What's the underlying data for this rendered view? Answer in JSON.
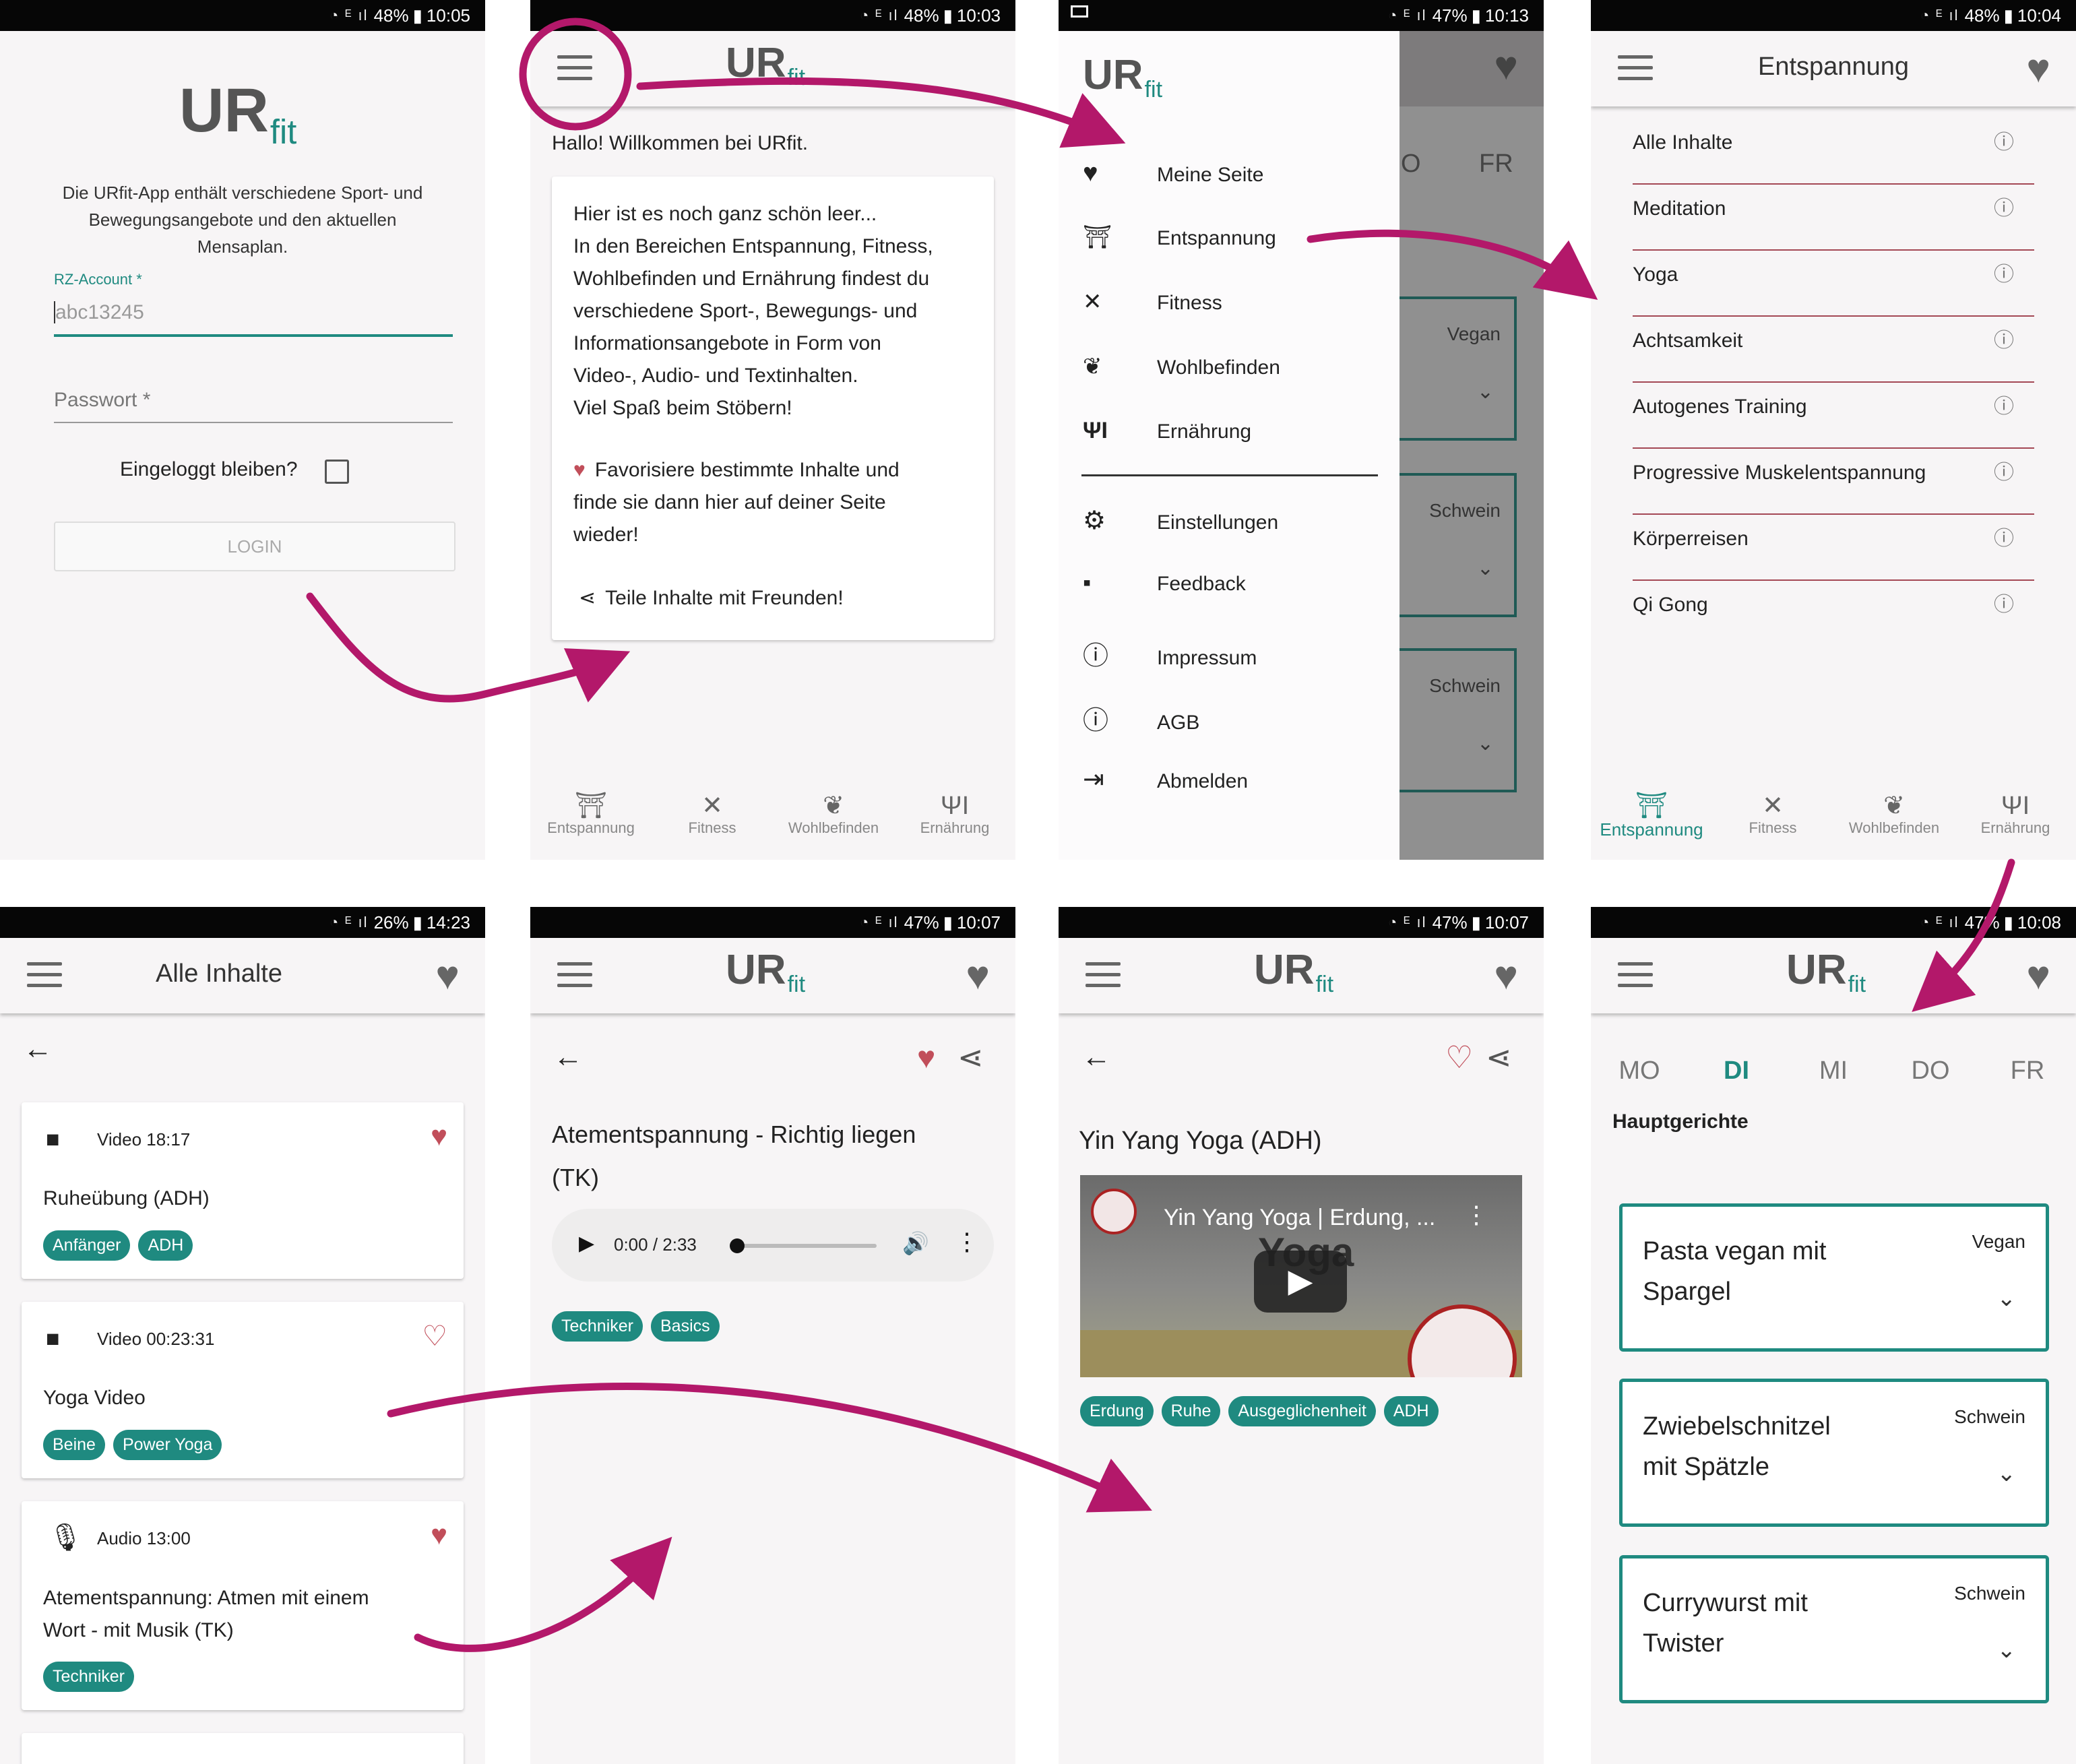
{
  "colors": {
    "accent": "#1f8a80",
    "arrow": "#b3186a",
    "heart": "#c14e5a",
    "drawer_rule": "#a44855"
  },
  "logo": {
    "main": "UR",
    "sub": "fit"
  },
  "screens": {
    "login": {
      "status": {
        "battery": "48%",
        "time": "10:05"
      },
      "description": "Die URfit-App enthält verschiedene Sport- und Bewegungsangebote und den aktuellen Mensaplan.",
      "account_label": "RZ-Account *",
      "account_placeholder": "abc13245",
      "password_label": "Passwort *",
      "remember_label": "Eingeloggt bleiben?",
      "login_button": "LOGIN"
    },
    "home": {
      "status": {
        "battery": "48%",
        "time": "10:03"
      },
      "welcome": "Hallo! Willkommen bei URfit.",
      "card_lines": [
        "Hier ist es noch ganz schön leer...",
        "In den Bereichen Entspannung, Fitness,",
        "Wohlbefinden und Ernährung findest du",
        "verschiedene Sport-, Bewegungs- und",
        "Informationsangebote in Form von",
        "Video-, Audio- und Textinhalten.",
        "Viel Spaß beim Stöbern!"
      ],
      "favorite_lines": [
        "Favorisiere bestimmte Inhalte und",
        "finde sie dann hier auf deiner Seite",
        "wieder!"
      ],
      "share_text": "Teile Inhalte mit Freunden!",
      "nav": [
        "Entspannung",
        "Fitness",
        "Wohlbefinden",
        "Ernährung"
      ]
    },
    "drawer": {
      "status": {
        "battery": "47%",
        "time": "10:13"
      },
      "items_top": [
        "Meine Seite",
        "Entspannung",
        "Fitness",
        "Wohlbefinden",
        "Ernährung"
      ],
      "items_bottom": [
        "Einstellungen",
        "Feedback",
        "Impressum",
        "AGB",
        "Abmelden"
      ],
      "behind": {
        "days": [
          "O",
          "FR"
        ],
        "tags": [
          "Vegan",
          "Schwein",
          "Schwein"
        ]
      }
    },
    "entspannung": {
      "status": {
        "battery": "48%",
        "time": "10:04"
      },
      "title": "Entspannung",
      "items": [
        "Alle Inhalte",
        "Meditation",
        "Yoga",
        "Achtsamkeit",
        "Autogenes Training",
        "Progressive Muskelentspannung",
        "Körperreisen",
        "Qi Gong"
      ],
      "nav": [
        "Entspannung",
        "Fitness",
        "Wohlbefinden",
        "Ernährung"
      ]
    },
    "alle": {
      "status": {
        "battery": "26%",
        "time": "14:23"
      },
      "title": "Alle Inhalte",
      "cards": [
        {
          "meta": "Video 18:17",
          "title": "Ruheübung (ADH)",
          "chips": [
            "Anfänger",
            "ADH"
          ]
        },
        {
          "meta": "Video 00:23:31",
          "title": "Yoga Video",
          "chips": [
            "Beine",
            "Power Yoga"
          ]
        },
        {
          "meta": "Audio 13:00",
          "title_lines": [
            "Atementspannung: Atmen mit einem",
            "Wort - mit Musik (TK)"
          ],
          "chips": [
            "Techniker"
          ]
        }
      ]
    },
    "audio": {
      "status": {
        "battery": "47%",
        "time": "10:07"
      },
      "title_lines": [
        "Atementspannung - Richtig liegen",
        "(TK)"
      ],
      "time": "0:00 / 2:33",
      "chips": [
        "Techniker",
        "Basics"
      ]
    },
    "video": {
      "status": {
        "battery": "47%",
        "time": "10:07"
      },
      "title": "Yin Yang Yoga (ADH)",
      "video_title": "Yin Yang Yoga | Erdung, ...",
      "video_overlay": "Yoga",
      "chips": [
        "Erdung",
        "Ruhe",
        "Ausgeglichenheit",
        "ADH"
      ]
    },
    "mensa": {
      "status": {
        "battery": "47%",
        "time": "10:08"
      },
      "days": [
        "MO",
        "DI",
        "MI",
        "DO",
        "FR"
      ],
      "section": "Hauptgerichte",
      "meals": [
        {
          "name_lines": [
            "Pasta vegan mit",
            "Spargel"
          ],
          "tag": "Vegan"
        },
        {
          "name_lines": [
            "Zwiebelschnitzel",
            "mit Spätzle"
          ],
          "tag": "Schwein"
        },
        {
          "name_lines": [
            "Currywurst mit",
            "Twister"
          ],
          "tag": "Schwein"
        }
      ]
    }
  }
}
